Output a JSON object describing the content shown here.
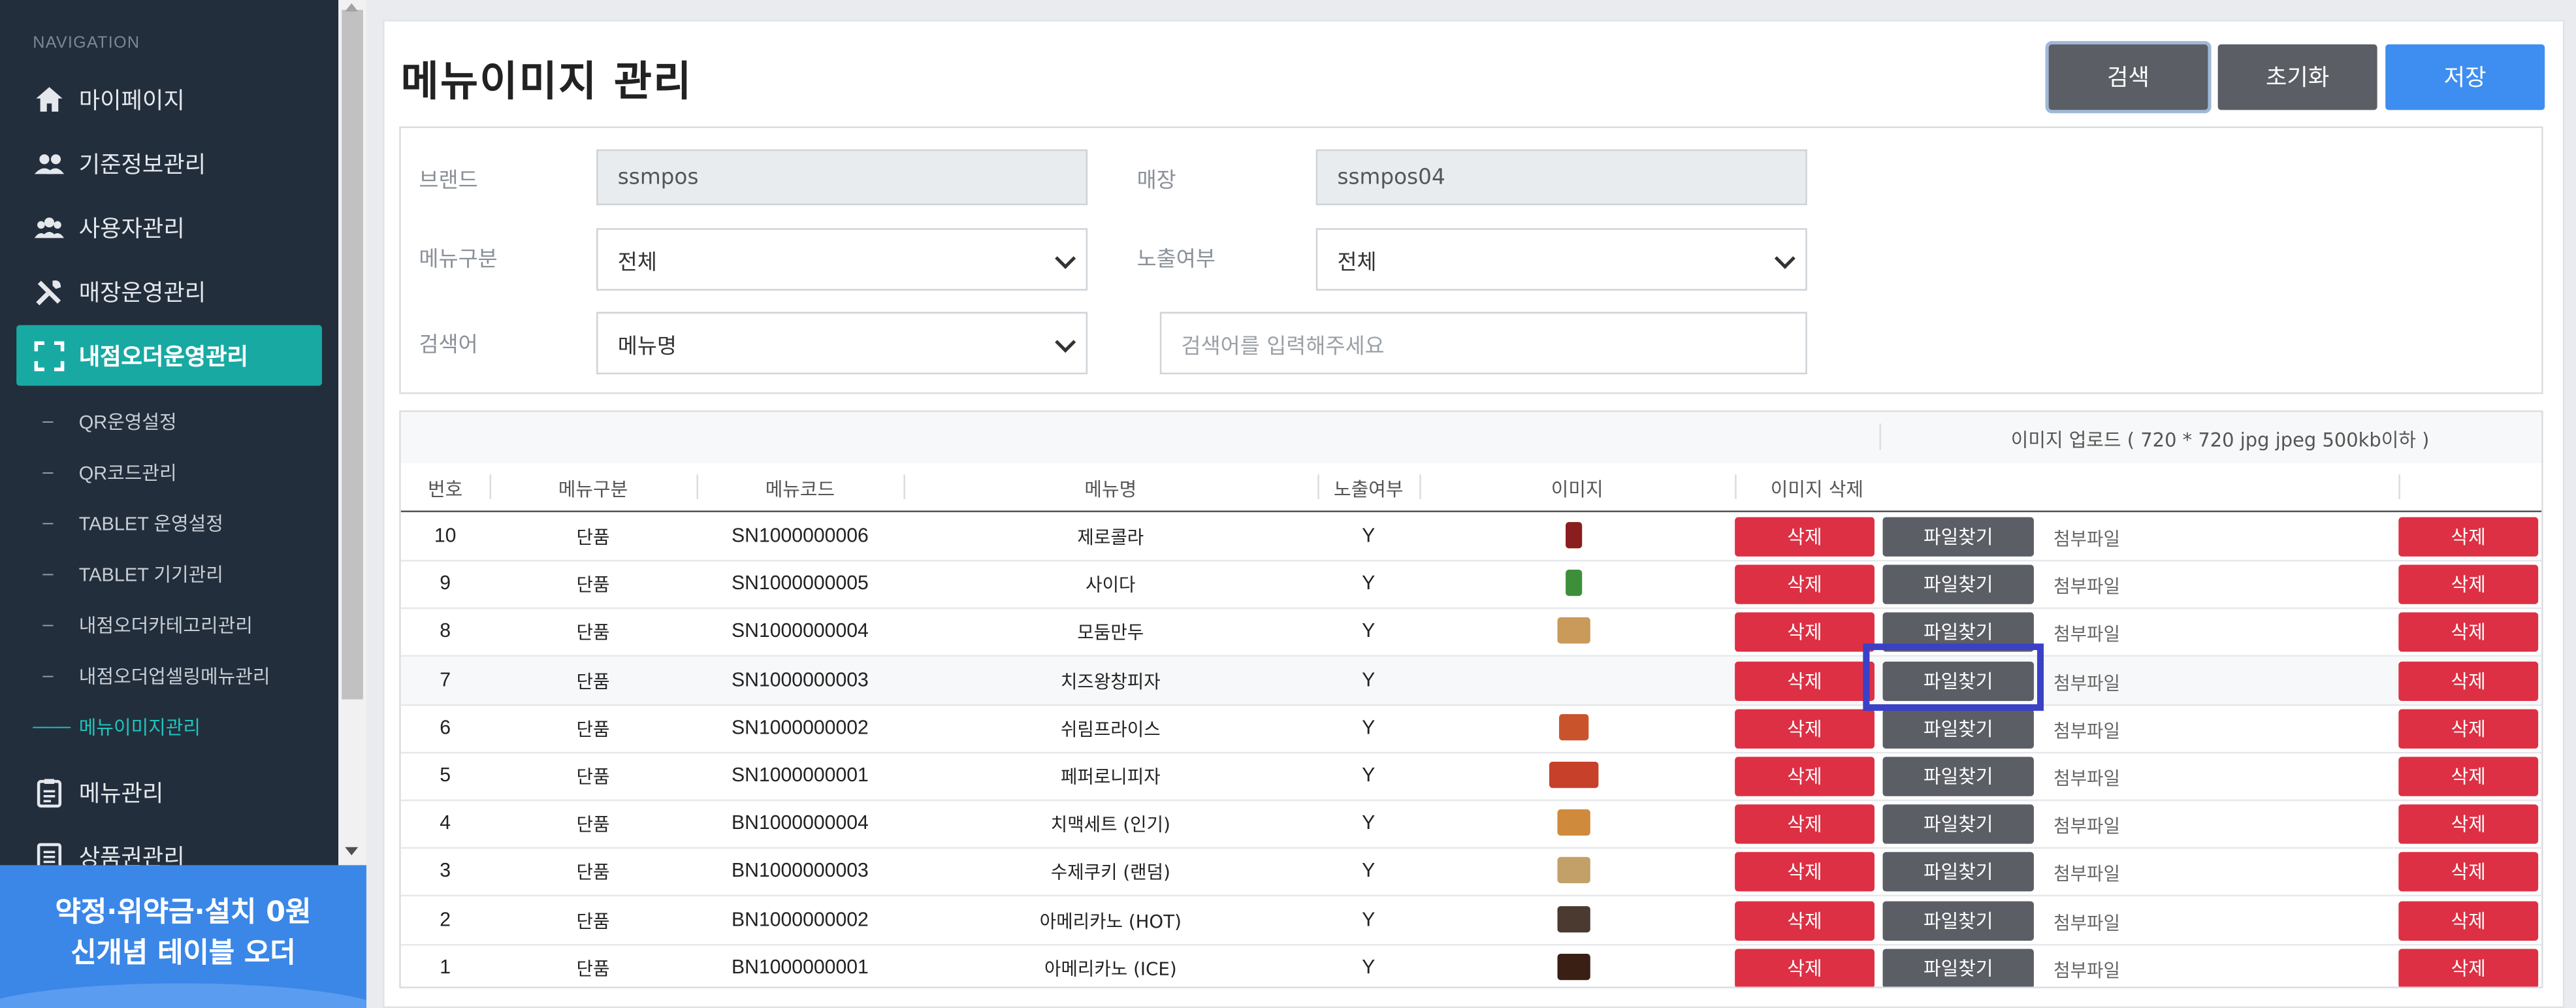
{
  "sidebar": {
    "heading": "NAVIGATION",
    "main_items": [
      {
        "label": "마이페이지",
        "icon": "home-icon"
      },
      {
        "label": "기준정보관리",
        "icon": "users-icon"
      },
      {
        "label": "사용자관리",
        "icon": "user-group-icon"
      },
      {
        "label": "매장운영관리",
        "icon": "tools-icon"
      },
      {
        "label": "내점오더운영관리",
        "icon": "focus-frame-icon"
      }
    ],
    "sub_items": [
      {
        "label": "QR운영설정"
      },
      {
        "label": "QR코드관리"
      },
      {
        "label": "TABLET 운영설정"
      },
      {
        "label": "TABLET 기기관리"
      },
      {
        "label": "내점오더카테고리관리"
      },
      {
        "label": "내점오더업셀링메뉴관리"
      },
      {
        "label": "메뉴이미지관리"
      }
    ],
    "bottom_items": [
      {
        "label": "메뉴관리",
        "icon": "clipboard-icon"
      },
      {
        "label": "상품권관리",
        "icon": "document-list-icon"
      }
    ],
    "banner": {
      "line1": "약정·위약금·설치 0원",
      "line2": "신개념 테이블 오더"
    }
  },
  "page": {
    "title": "메뉴이미지 관리",
    "buttons": {
      "search": "검색",
      "reset": "초기화",
      "save": "저장"
    }
  },
  "filters": {
    "brand_label": "브랜드",
    "brand_value": "ssmpos",
    "store_label": "매장",
    "store_value": "ssmpos04",
    "menu_type_label": "메뉴구분",
    "menu_type_value": "전체",
    "exposure_label": "노출여부",
    "exposure_value": "전체",
    "keyword_label": "검색어",
    "keyword_type_value": "메뉴명",
    "keyword_placeholder": "검색어를 입력해주세요"
  },
  "table": {
    "upload_header": "이미지 업로드 ( 720 * 720 jpg jpeg 500kb이하 )",
    "columns": [
      "번호",
      "메뉴구분",
      "메뉴코드",
      "메뉴명",
      "노출여부",
      "이미지",
      "이미지 삭제"
    ],
    "delete_label": "삭제",
    "file_label": "파일찾기",
    "attach_label": "첨부파일",
    "rows": [
      {
        "no": "10",
        "type": "단품",
        "code": "SN1000000006",
        "name": "제로콜라",
        "exposed": "Y",
        "thumb": "cola-thumb",
        "color": "#8a1d1d"
      },
      {
        "no": "9",
        "type": "단품",
        "code": "SN1000000005",
        "name": "사이다",
        "exposed": "Y",
        "thumb": "cider-thumb",
        "color": "#3d8f3a"
      },
      {
        "no": "8",
        "type": "단품",
        "code": "SN1000000004",
        "name": "모둠만두",
        "exposed": "Y",
        "thumb": "dumpling-thumb",
        "color": "#c99a5a"
      },
      {
        "no": "7",
        "type": "단품",
        "code": "SN1000000003",
        "name": "치즈왕창피자",
        "exposed": "Y",
        "thumb": "",
        "color": ""
      },
      {
        "no": "6",
        "type": "단품",
        "code": "SN1000000002",
        "name": "쉬림프라이스",
        "exposed": "Y",
        "thumb": "shrimp-thumb",
        "color": "#c9542c"
      },
      {
        "no": "5",
        "type": "단품",
        "code": "SN1000000001",
        "name": "페퍼로니피자",
        "exposed": "Y",
        "thumb": "pizza-thumb",
        "color": "#c7402a"
      },
      {
        "no": "4",
        "type": "단품",
        "code": "BN1000000004",
        "name": "치맥세트 (인기)",
        "exposed": "Y",
        "thumb": "chicken-thumb",
        "color": "#d08a3c"
      },
      {
        "no": "3",
        "type": "단품",
        "code": "BN1000000003",
        "name": "수제쿠키 (랜덤)",
        "exposed": "Y",
        "thumb": "cookie-thumb",
        "color": "#c2a068"
      },
      {
        "no": "2",
        "type": "단품",
        "code": "BN1000000002",
        "name": "아메리카노 (HOT)",
        "exposed": "Y",
        "thumb": "coffee-hot-thumb",
        "color": "#4a3a30"
      },
      {
        "no": "1",
        "type": "단품",
        "code": "BN1000000001",
        "name": "아메리카노 (ICE)",
        "exposed": "Y",
        "thumb": "coffee-ice-thumb",
        "color": "#3a1f14"
      }
    ]
  }
}
